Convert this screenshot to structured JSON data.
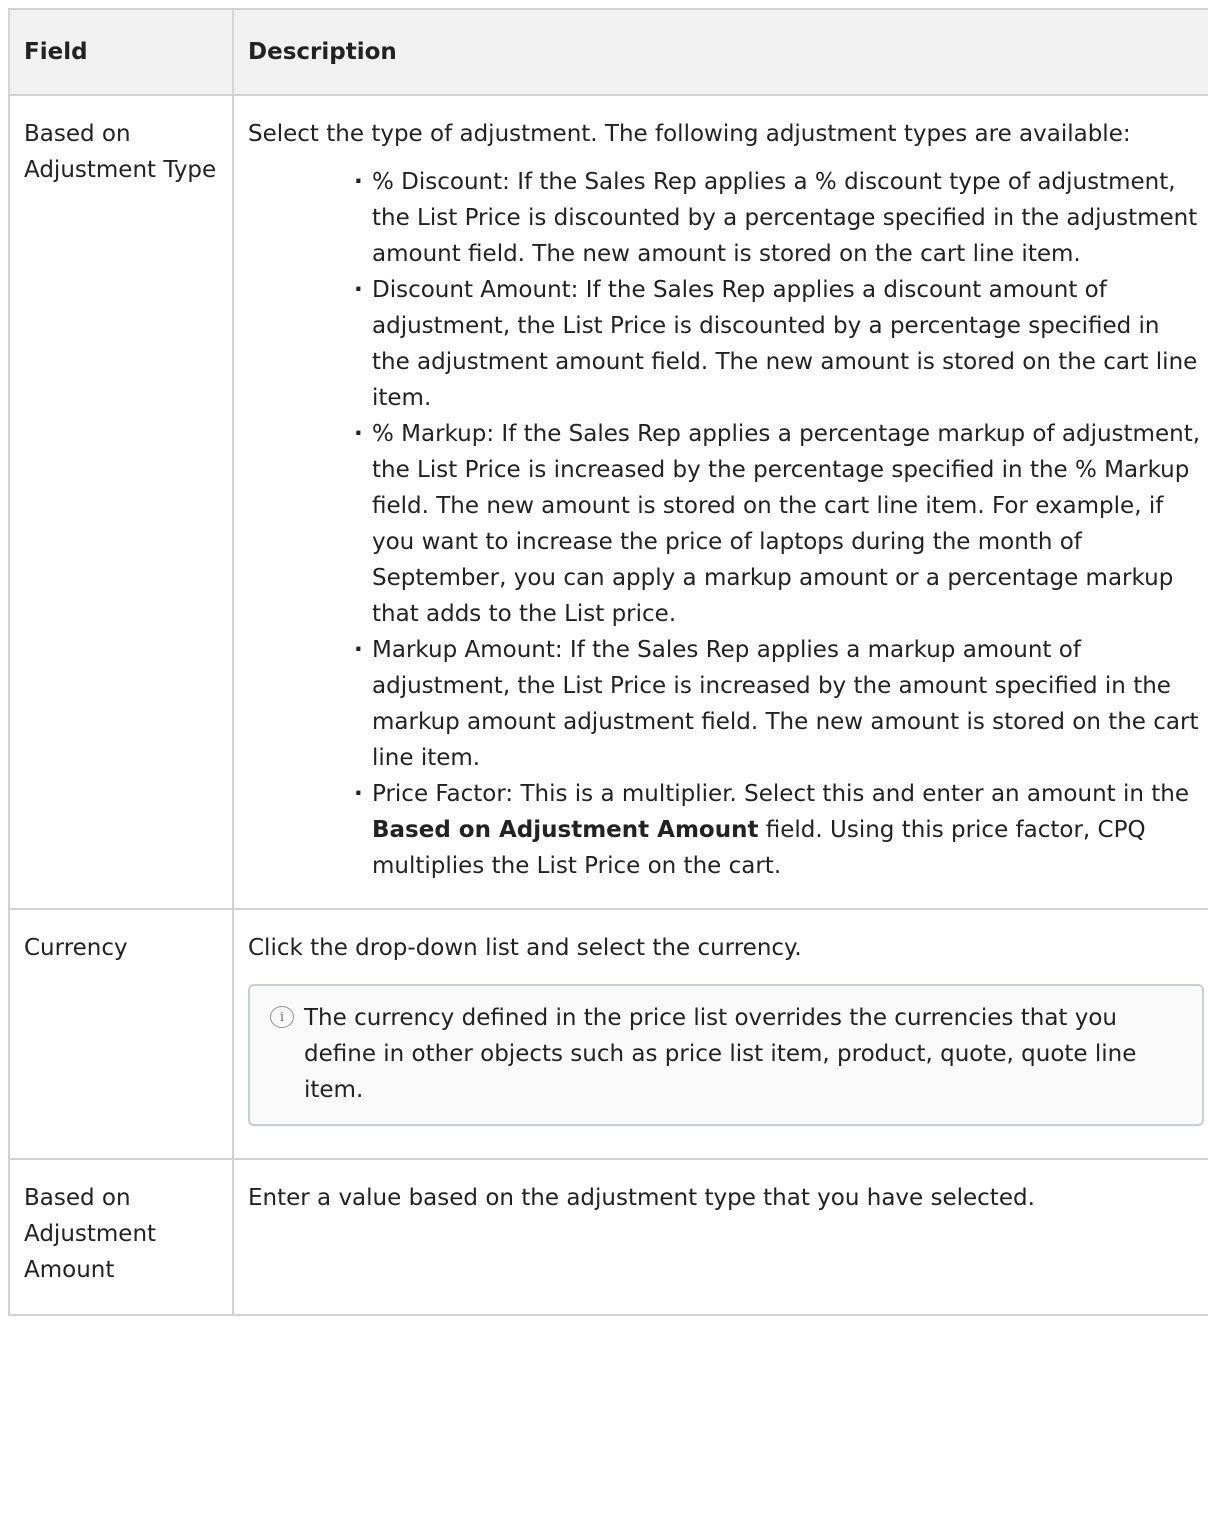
{
  "table": {
    "headers": {
      "field": "Field",
      "description": "Description"
    },
    "rows": {
      "adjustment_type": {
        "field": "Based on Adjustment Type",
        "intro": "Select the type of adjustment. The following adjustment types are available:",
        "items": [
          "% Discount: If the Sales Rep applies a % discount type of adjustment, the List Price is discounted by a percentage specified in the adjustment amount field. The new amount is stored on the cart line item.",
          "Discount Amount: If the Sales Rep applies a discount amount of adjustment, the List Price is discounted by a percentage specified in the adjustment amount field. The new amount is stored on the cart line item.",
          "% Markup: If the Sales Rep applies a percentage markup of adjustment, the List Price is increased by the percentage specified in the % Markup field. The new amount is stored on the cart line item. For example, if you want to increase the price of laptops during the month of September, you can apply a markup amount or a percentage markup that adds to the List price.",
          "Markup Amount: If the Sales Rep applies a markup amount of adjustment, the List Price is increased by the amount specified in the markup amount adjustment field. The new amount is stored on the cart line item."
        ],
        "price_factor": {
          "before": "Price Factor: This is a multiplier. Select this and enter an amount in the ",
          "bold": "Based on Adjustment Amount",
          "after": " field. Using this price factor, CPQ multiplies the List Price on the cart."
        }
      },
      "currency": {
        "field": "Currency",
        "description": "Click the drop-down list and select the currency.",
        "note": "The currency defined in the price list overrides the currencies that you define in other objects such as price list item, product, quote, quote line item.",
        "note_icon": "info-icon"
      },
      "adjustment_amount": {
        "field": "Based on Adjustment Amount",
        "description": "Enter a value based on the adjustment type that you have selected."
      }
    }
  }
}
